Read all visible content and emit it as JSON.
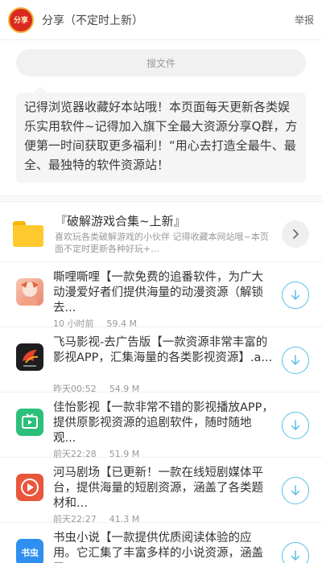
{
  "header": {
    "avatar_text": "分享",
    "title": "分享（不定时上新）",
    "report_label": "举报"
  },
  "search": {
    "placeholder": "搜文件"
  },
  "announcement": {
    "text": "记得浏览器收藏好本站哦！本页面每天更新各类娱乐实用软件~记得加入旗下全最大资源分享Q群，方便第一时间获取更多福利！“用心去打造全最牛、最全、最独特的软件资源站！"
  },
  "folder": {
    "title": "『破解游戏合集~上新』",
    "desc": "喜欢玩各类破解游戏的小伙伴 记得收藏本网站哦~本页面不定时更新各种好玩+..."
  },
  "files": [
    {
      "title": "嘶哩嘶哩【一款免费的追番软件，为广大动漫爱好者们提供海量的动漫资源（解锁去...",
      "time": "10 小时前",
      "size": "59.4 M",
      "icon": "sili-app-icon"
    },
    {
      "title": "飞马影视-去广告版【一款资源非常丰富的影视APP，汇集海量的各类影视资源】.a...",
      "time": "昨天00:52",
      "size": "54.9 M",
      "icon": "feima-app-icon"
    },
    {
      "title": "佳怡影视【一款非常不错的影视播放APP，提供原影视资源的追剧软件，随时随地观...",
      "time": "前天22:28",
      "size": "51.9 M",
      "icon": "jiayi-app-icon"
    },
    {
      "title": "河马剧场【已更新！一款在线短剧媒体平台，提供海量的短剧资源，涵盖了各类题材和...",
      "time": "前天22:27",
      "size": "41.3 M",
      "icon": "hema-app-icon"
    },
    {
      "title": "书虫小说【一款提供优质阅读体验的应用。它汇集了丰富多样的小说资源，涵盖了...",
      "time": "",
      "size": "",
      "icon": "shuchong-app-icon",
      "icon_text": "书虫"
    }
  ],
  "colors": {
    "accent": "#5bbde9",
    "folder": "#ffc92e",
    "avatar": "#d92a1f"
  }
}
